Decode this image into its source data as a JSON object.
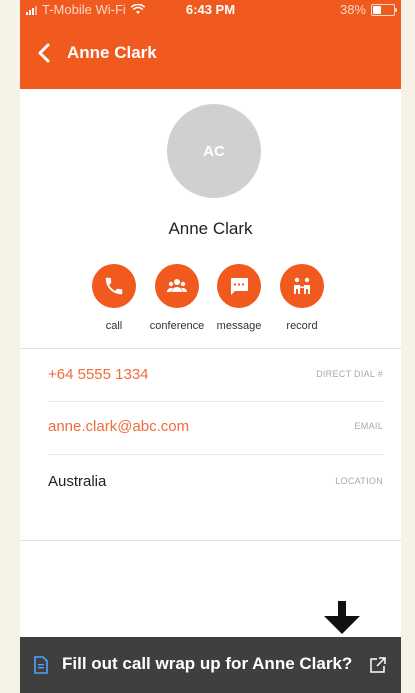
{
  "status_bar": {
    "carrier": "T-Mobile Wi-Fi",
    "time": "6:43 PM",
    "battery_text": "38%",
    "battery_level": 0.38
  },
  "nav": {
    "title": "Anne Clark",
    "back_icon": "chevron-left-icon"
  },
  "contact": {
    "initials": "AC",
    "name": "Anne Clark"
  },
  "actions": [
    {
      "label": "call",
      "icon": "phone-icon"
    },
    {
      "label": "conference",
      "icon": "group-icon"
    },
    {
      "label": "message",
      "icon": "chat-icon"
    },
    {
      "label": "record",
      "icon": "record-icon"
    }
  ],
  "details": [
    {
      "value": "+64 5555 1334",
      "label": "DIRECT DIAL #"
    },
    {
      "value": "anne.clark@abc.com",
      "label": "EMAIL"
    },
    {
      "value": "Australia",
      "label": "LOCATION"
    }
  ],
  "banner": {
    "text": "Fill out call wrap up for Anne Clark?",
    "doc_icon": "document-icon",
    "open_icon": "external-link-icon"
  },
  "colors": {
    "accent": "#f05a1e",
    "banner_bg": "#3f3f3f",
    "avatar_bg": "#d0d0d0"
  }
}
